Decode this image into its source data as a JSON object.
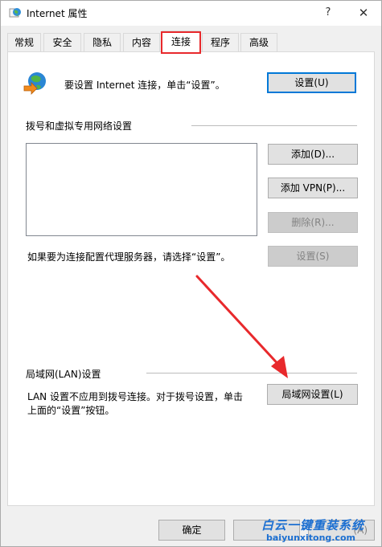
{
  "window": {
    "title": "Internet 属性",
    "help": "?",
    "close": "✕",
    "icon": "internet-globe-icon"
  },
  "tabs": [
    {
      "label": "常规",
      "active": false
    },
    {
      "label": "安全",
      "active": false
    },
    {
      "label": "隐私",
      "active": false
    },
    {
      "label": "内容",
      "active": false
    },
    {
      "label": "连接",
      "active": true
    },
    {
      "label": "程序",
      "active": false
    },
    {
      "label": "高级",
      "active": false
    }
  ],
  "setup": {
    "text": "要设置 Internet 连接，单击“设置”。",
    "button": "设置(U)",
    "icon": "network-setup-icon"
  },
  "dialup": {
    "group_title": "拨号和虚拟专用网络设置",
    "add_button": "添加(D)...",
    "add_vpn_button": "添加 VPN(P)...",
    "delete_button": "删除(R)...",
    "proxy_text": "如果要为连接配置代理服务器，请选择“设置”。",
    "settings_button": "设置(S)"
  },
  "lan": {
    "group_title": "局域网(LAN)设置",
    "text_line1": "LAN 设置不应用到拨号连接。对于拨号设置，单击",
    "text_line2": "上面的“设置”按钮。",
    "button": "局域网设置(L)"
  },
  "footer": {
    "ok_button": "确定",
    "apply_partial": "(A)"
  },
  "watermark": {
    "cn": "白云一键重装系统",
    "url": "baiyunxitong.com"
  },
  "colors": {
    "highlight": "#e8292c",
    "focus": "#0078d7",
    "watermark": "#1c6fd1"
  }
}
